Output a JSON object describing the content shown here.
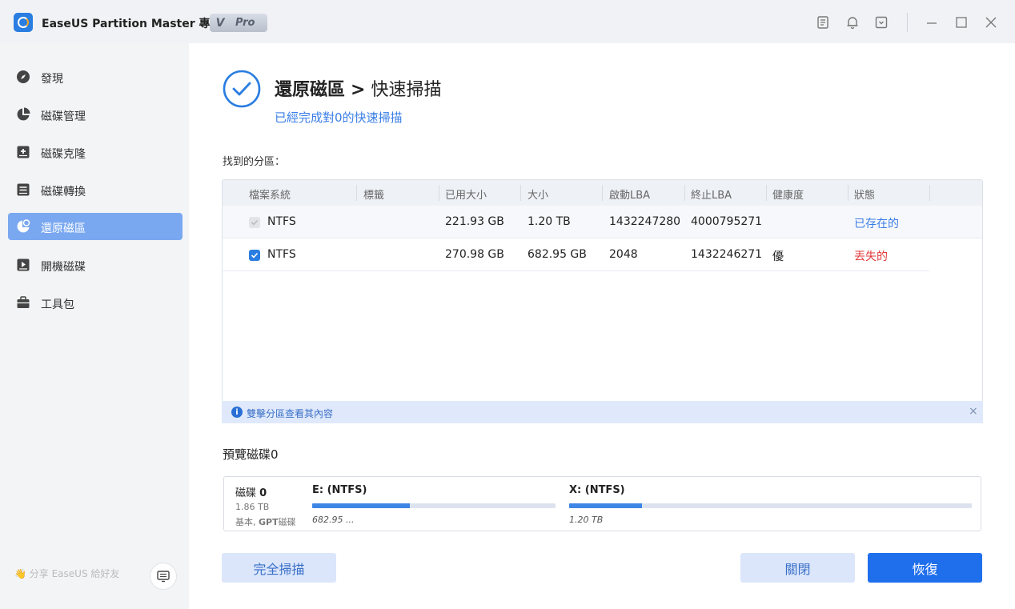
{
  "app": {
    "title": "EaseUS Partition Master 專業版",
    "badge_v": "V",
    "badge_text": "Pro"
  },
  "sidebar": {
    "items": [
      {
        "label": "發現",
        "icon": "compass-icon"
      },
      {
        "label": "磁碟管理",
        "icon": "pie-chart-icon"
      },
      {
        "label": "磁碟克隆",
        "icon": "disk-clone-icon"
      },
      {
        "label": "磁碟轉換",
        "icon": "disk-convert-icon"
      },
      {
        "label": "還原磁區",
        "icon": "partition-recovery-icon",
        "active": true
      },
      {
        "label": "開機磁碟",
        "icon": "bootable-disk-icon"
      },
      {
        "label": "工具包",
        "icon": "toolbox-icon"
      }
    ],
    "footer_text": "分享 EaseUS 給好友"
  },
  "main": {
    "title_bold": "還原磁區",
    "title_sep": ">",
    "title_rest": "快速掃描",
    "subtitle": "已經完成對0的快速掃描",
    "found_label": "找到的分區："
  },
  "table": {
    "headers": [
      "檔案系統",
      "標籤",
      "已用大小",
      "大小",
      "啟動LBA",
      "終止LBA",
      "健康度",
      "狀態"
    ],
    "rows": [
      {
        "checkbox": "disabled",
        "fs": "NTFS",
        "label": "",
        "used": "221.93 GB",
        "size": "1.20 TB",
        "start_lba": "1432247280",
        "end_lba": "4000795271",
        "health": "",
        "status": "已存在的"
      },
      {
        "checkbox": "checked",
        "fs": "NTFS",
        "label": "",
        "used": "270.98 GB",
        "size": "682.95 GB",
        "start_lba": "2048",
        "end_lba": "1432246271",
        "health": "優",
        "status": "丟失的"
      }
    ]
  },
  "info_bar": {
    "text": "雙擊分區查看其內容",
    "close": "×"
  },
  "preview": {
    "label": "預覽磁碟0",
    "disk_name": "磁碟",
    "disk_index": "0",
    "disk_size": "1.86 TB",
    "disk_type_prefix": "基本, ",
    "disk_type_bold": "GPT",
    "disk_type_suffix": "磁碟",
    "partitions": [
      {
        "label": "E: (NTFS)",
        "size": "682.95 ...",
        "fill": 0.4
      },
      {
        "label": "X: (NTFS)",
        "size": "1.20 TB",
        "fill": 0.18
      }
    ]
  },
  "buttons": {
    "full_scan": "完全掃描",
    "close": "關閉",
    "restore": "恢復"
  },
  "colors": {
    "accent": "#1f6fec",
    "active_nav": "#7aa8f0",
    "status_exist": "#3a7ee6",
    "status_lost": "#e03a3a"
  }
}
